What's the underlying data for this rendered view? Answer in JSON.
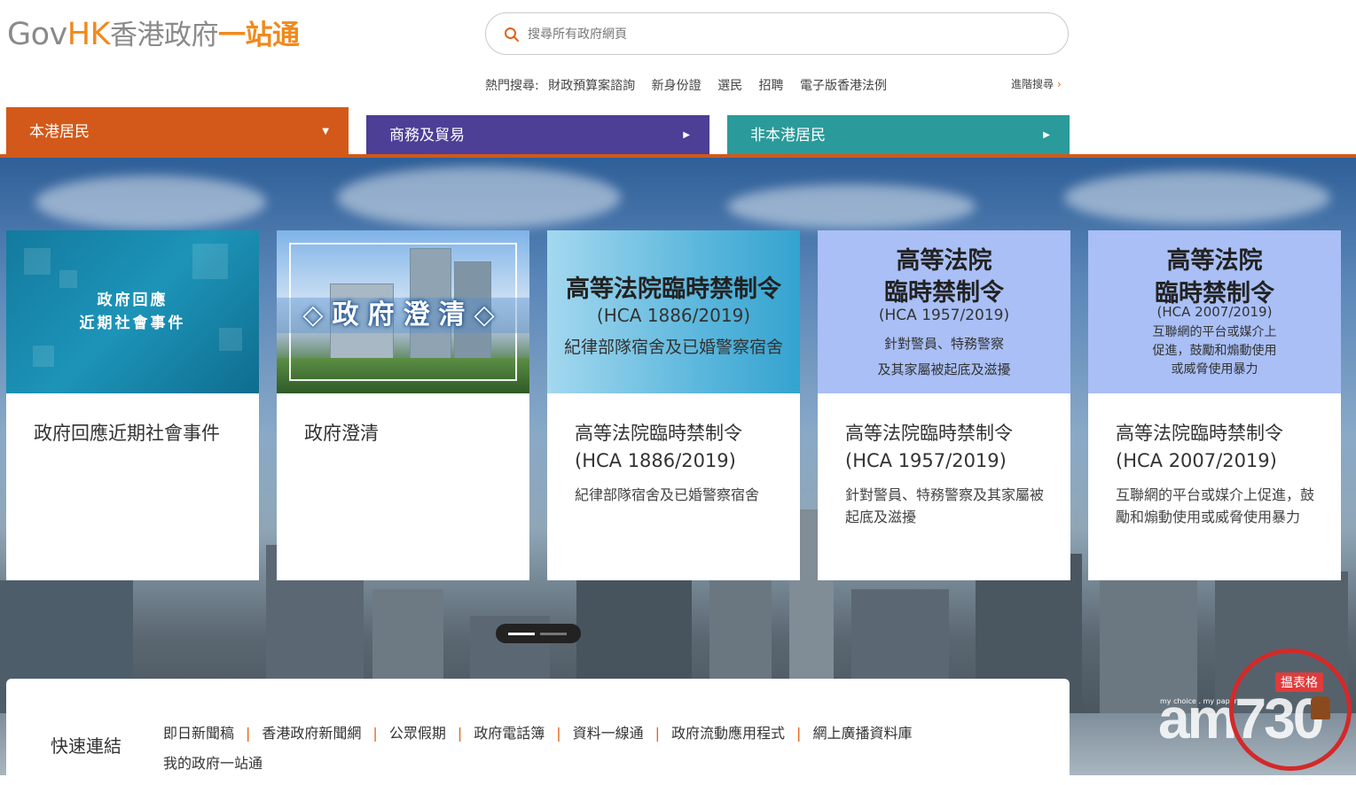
{
  "logo": {
    "gov": "Gov",
    "hk": "HK",
    "zh_main": "香港政府",
    "zh_accent": "一站通"
  },
  "search": {
    "placeholder": "搜尋所有政府網頁",
    "value": ""
  },
  "hot_search": {
    "label": "熱門搜尋:",
    "items": [
      "財政預算案諮詢",
      "新身份證",
      "選民",
      "招聘",
      "電子版香港法例"
    ],
    "advanced": "進階搜尋"
  },
  "tabs": [
    {
      "label": "本港居民",
      "color": "#d2591a",
      "active": true,
      "indicator": "▼"
    },
    {
      "label": "商務及貿易",
      "color": "#4d3e96",
      "active": false,
      "indicator": "▶"
    },
    {
      "label": "非本港居民",
      "color": "#2b9a9a",
      "active": false,
      "indicator": "▶"
    }
  ],
  "cards": [
    {
      "image_lines": [
        "政府回應",
        "近期社會事件"
      ],
      "title": "政府回應近期社會事件",
      "desc": ""
    },
    {
      "image_lines": [
        "◇政府澄清◇"
      ],
      "title": "政府澄清",
      "desc": ""
    },
    {
      "image_lines": [
        "高等法院臨時禁制令",
        "(HCA 1886/2019)",
        "紀律部隊宿舍及已婚警察宿舍"
      ],
      "title": "高等法院臨時禁制令 (HCA 1886/2019)",
      "desc": "紀律部隊宿舍及已婚警察宿舍"
    },
    {
      "image_lines": [
        "高等法院",
        "臨時禁制令",
        "(HCA 1957/2019)",
        "針對警員、特務警察",
        "及其家屬被起底及滋擾"
      ],
      "title": "高等法院臨時禁制令 (HCA 1957/2019)",
      "desc": "針對警員、特務警察及其家屬被起底及滋擾"
    },
    {
      "image_lines": [
        "高等法院",
        "臨時禁制令",
        "(HCA 2007/2019)",
        "互聯網的平台或媒介上",
        "促進，鼓勵和煽動使用",
        "或威脅使用暴力"
      ],
      "title": "高等法院臨時禁制令 (HCA 2007/2019)",
      "desc": "互聯網的平台或媒介上促進，鼓勵和煽動使用或威脅使用暴力"
    }
  ],
  "quick_links": {
    "label": "快速連結",
    "items": [
      "即日新聞稿",
      "香港政府新聞網",
      "公眾假期",
      "政府電話簿",
      "資料一線通",
      "政府流動應用程式",
      "網上廣播資料庫",
      "我的政府一站通"
    ],
    "separator": "|"
  },
  "watermark": {
    "brand": "am730",
    "slogan": "my choice . my paper",
    "tag": "揾表格"
  },
  "colors": {
    "accent": "#d2591a",
    "logo_orange": "#f08a1c",
    "logo_gray": "#8a8a8a"
  }
}
